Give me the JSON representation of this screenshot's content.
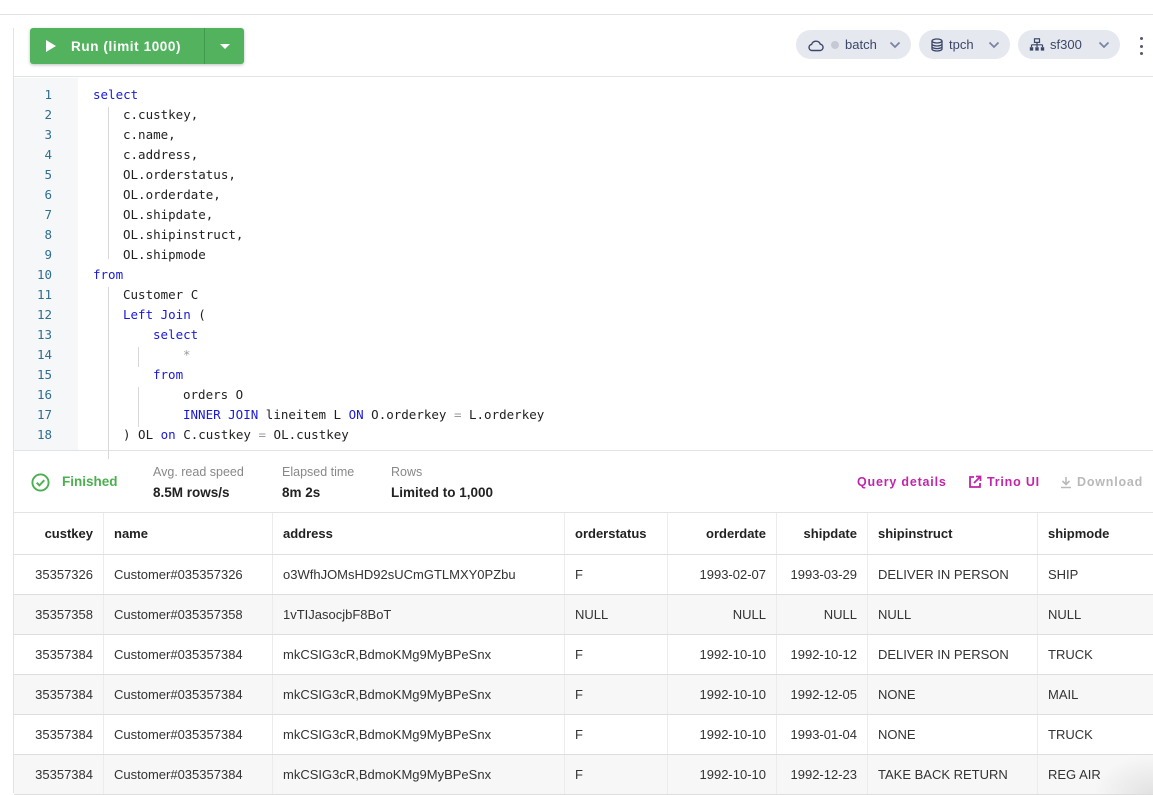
{
  "toolbar": {
    "run_label": "Run (limit 1000)",
    "cluster": {
      "label": "batch",
      "icon": "cloud-icon",
      "status_color": "#c6c9d3"
    },
    "catalog": {
      "label": "tpch",
      "icon": "database-icon"
    },
    "schema": {
      "label": "sf300",
      "icon": "schema-tree-icon"
    },
    "run_color": "#52b25e"
  },
  "editor": {
    "lines": [
      {
        "n": "1",
        "text": "select"
      },
      {
        "n": "2",
        "text": "c.custkey,"
      },
      {
        "n": "3",
        "text": "c.name,"
      },
      {
        "n": "4",
        "text": "c.address,"
      },
      {
        "n": "5",
        "text": "OL.orderstatus,"
      },
      {
        "n": "6",
        "text": "OL.orderdate,"
      },
      {
        "n": "7",
        "text": "OL.shipdate,"
      },
      {
        "n": "8",
        "text": "OL.shipinstruct,"
      },
      {
        "n": "9",
        "text": "OL.shipmode"
      },
      {
        "n": "10",
        "text": "from"
      },
      {
        "n": "11",
        "text": "Customer C"
      },
      {
        "n": "12",
        "text": "Left Join ("
      },
      {
        "n": "13",
        "text": "select"
      },
      {
        "n": "14",
        "text": "*"
      },
      {
        "n": "15",
        "text": "from"
      },
      {
        "n": "16",
        "text": "orders O"
      },
      {
        "n": "17",
        "text": "INNER JOIN lineitem L ON O.orderkey = L.orderkey"
      },
      {
        "n": "18",
        "text": ") OL on C.custkey = OL.custkey"
      }
    ],
    "tokens": {
      "l1": "select",
      "l10": "from",
      "l12_kw": "Left Join",
      "l12_rest": " (",
      "l13": "select",
      "l14": "*",
      "l15": "from",
      "l17_kw1": "INNER JOIN",
      "l17_mid": " lineitem L ",
      "l17_kw2": "ON",
      "l17_rest1": " O.orderkey ",
      "l17_eq": "=",
      "l17_rest2": " L.orderkey",
      "l18_a": ") OL ",
      "l18_kw": "on",
      "l18_b": " C.custkey ",
      "l18_eq": "=",
      "l18_c": " OL.custkey"
    }
  },
  "status": {
    "state": "Finished",
    "state_color": "#4caf50",
    "read_speed_label": "Avg. read speed",
    "read_speed_value": "8.5M rows/s",
    "elapsed_label": "Elapsed time",
    "elapsed_value": "8m 2s",
    "rows_label": "Rows",
    "rows_value": "Limited to 1,000",
    "query_details": "Query details",
    "trino_ui": "Trino UI",
    "download": "Download"
  },
  "table": {
    "columns": [
      "custkey",
      "name",
      "address",
      "orderstatus",
      "orderdate",
      "shipdate",
      "shipinstruct",
      "shipmode"
    ],
    "rows": [
      [
        "35357326",
        "Customer#035357326",
        "o3WfhJOMsHD92sUCmGTLMXY0PZbu",
        "F",
        "1993-02-07",
        "1993-03-29",
        "DELIVER IN PERSON",
        "SHIP"
      ],
      [
        "35357358",
        "Customer#035357358",
        "1vTIJasocjbF8BoT",
        "NULL",
        "NULL",
        "NULL",
        "NULL",
        "NULL"
      ],
      [
        "35357384",
        "Customer#035357384",
        "mkCSIG3cR,BdmoKMg9MyBPeSnx",
        "F",
        "1992-10-10",
        "1992-10-12",
        "DELIVER IN PERSON",
        "TRUCK"
      ],
      [
        "35357384",
        "Customer#035357384",
        "mkCSIG3cR,BdmoKMg9MyBPeSnx",
        "F",
        "1992-10-10",
        "1992-12-05",
        "NONE",
        "MAIL"
      ],
      [
        "35357384",
        "Customer#035357384",
        "mkCSIG3cR,BdmoKMg9MyBPeSnx",
        "F",
        "1992-10-10",
        "1993-01-04",
        "NONE",
        "TRUCK"
      ],
      [
        "35357384",
        "Customer#035357384",
        "mkCSIG3cR,BdmoKMg9MyBPeSnx",
        "F",
        "1992-10-10",
        "1992-12-23",
        "TAKE BACK RETURN",
        "REG AIR"
      ]
    ]
  }
}
